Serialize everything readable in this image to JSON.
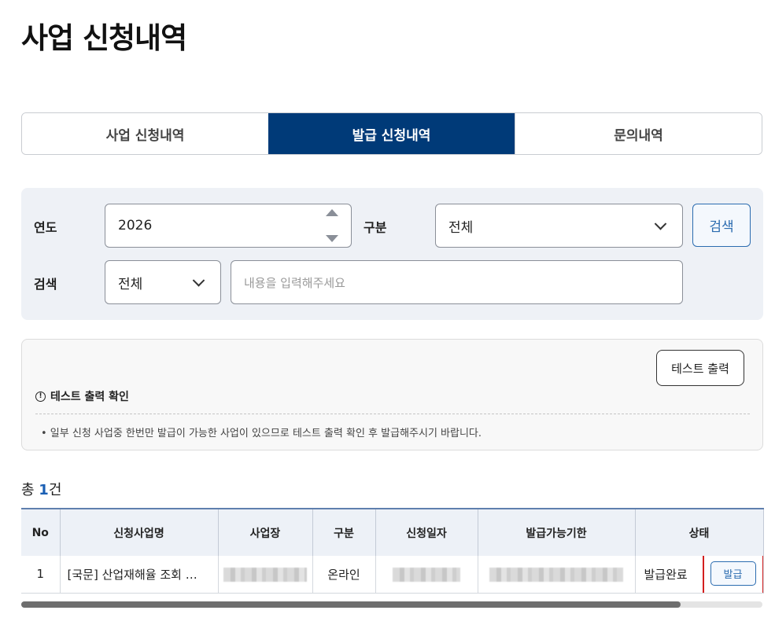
{
  "page": {
    "title": "사업 신청내역"
  },
  "tabs": [
    {
      "label": "사업 신청내역",
      "active": false
    },
    {
      "label": "발급 신청내역",
      "active": true
    },
    {
      "label": "문의내역",
      "active": false
    }
  ],
  "search": {
    "year_label": "연도",
    "year_value": "2026",
    "category_label": "구분",
    "category_value": "전체",
    "search_label": "검색",
    "search_type_value": "전체",
    "keyword_placeholder": "내용을 입력해주세요",
    "search_button": "검색"
  },
  "notice": {
    "test_print_button": "테스트 출력",
    "heading": "테스트 출력 확인",
    "body": "• 일부 신청 사업중 한번만 발급이 가능한 사업이 있으므로 테스트 출력 확인 후 발급해주시기 바랍니다."
  },
  "summary": {
    "prefix": "총 ",
    "count": "1",
    "suffix": "건"
  },
  "table": {
    "columns": [
      "No",
      "신청사업명",
      "사업장",
      "구분",
      "신청일자",
      "발급가능기한",
      "상태"
    ],
    "rows": [
      {
        "no": "1",
        "name": "[국문] 산업재해율 조회 …",
        "type": "온라인",
        "status": "발급완료",
        "action": "발급"
      }
    ]
  },
  "colors": {
    "accent": "#003a78",
    "link": "#2b6cb0",
    "highlight": "#d31f1f"
  }
}
